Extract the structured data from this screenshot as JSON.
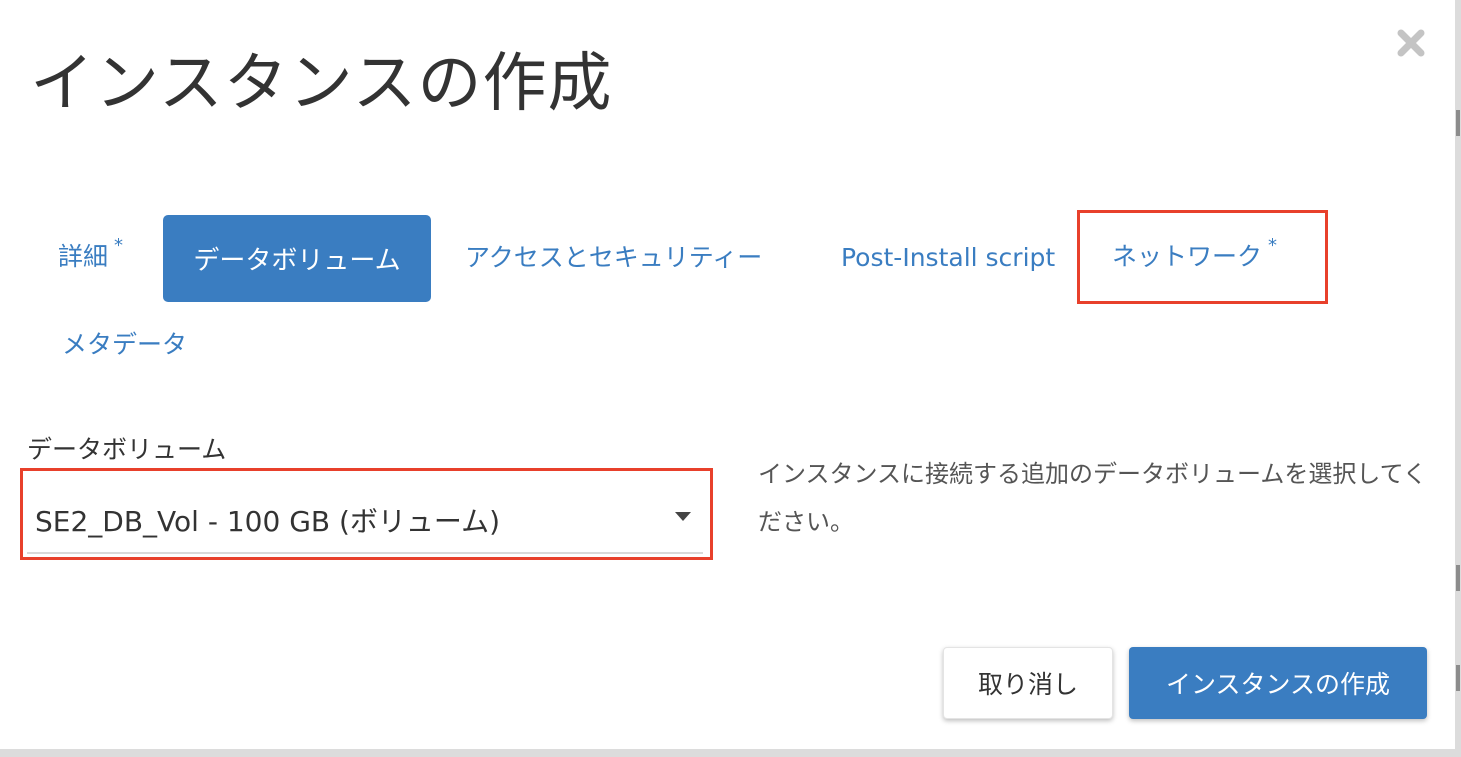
{
  "modal": {
    "title": "インスタンスの作成"
  },
  "tabs": {
    "details": {
      "label": "詳細",
      "required_mark": "*"
    },
    "data_volume": {
      "label": "データボリューム"
    },
    "access_security": {
      "label": "アクセスとセキュリティー"
    },
    "post_install": {
      "label": "Post-Install script"
    },
    "network": {
      "label": "ネットワーク",
      "required_mark": "*"
    },
    "metadata": {
      "label": "メタデータ"
    }
  },
  "form": {
    "data_volume_label": "データボリューム",
    "data_volume_selected": "SE2_DB_Vol - 100 GB (ボリューム)",
    "help_text": "インスタンスに接続する追加のデータボリュームを選択してください。"
  },
  "footer": {
    "cancel_label": "取り消し",
    "submit_label": "インスタンスの作成"
  },
  "colors": {
    "accent": "#3a7dc1",
    "highlight_box": "#e8402b",
    "title_text": "#333333"
  },
  "icons": {
    "close": "close-icon",
    "dropdown": "caret-down-icon"
  }
}
